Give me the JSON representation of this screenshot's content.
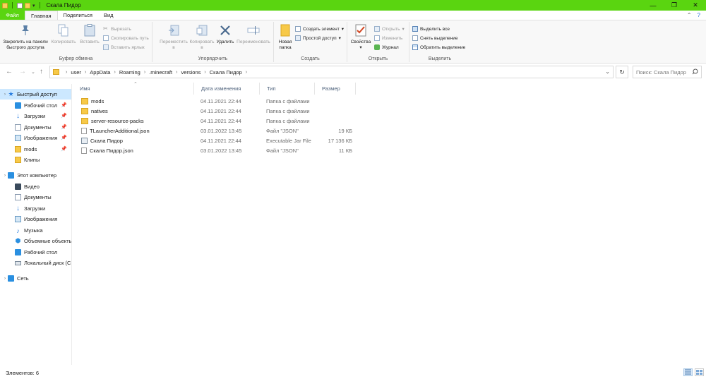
{
  "window": {
    "title": "Скала Пидор",
    "controls": {
      "minimize": "—",
      "maximize": "❐",
      "close": "✕"
    },
    "accent_color": "#5ad510"
  },
  "ribbon_tabs": [
    "Файл",
    "Главная",
    "Поделиться",
    "Вид"
  ],
  "ribbon": {
    "clipboard": {
      "label": "Буфер обмена",
      "pin": "Закрепить на панели быстрого доступа",
      "copy": "Копировать",
      "paste": "Вставить",
      "cut": "Вырезать",
      "copy_path": "Скопировать путь",
      "paste_shortcut": "Вставить ярлык"
    },
    "organize": {
      "label": "Упорядочить",
      "move": "Переместить в",
      "copy_to": "Копировать в",
      "delete": "Удалить",
      "rename": "Переименовать"
    },
    "create": {
      "label": "Создать",
      "new_folder": "Новая папка",
      "new_item": "Создать элемент",
      "easy_access": "Простой доступ"
    },
    "open": {
      "label": "Открыть",
      "properties": "Свойства",
      "open": "Открыть",
      "edit": "Изменить",
      "history": "Журнал"
    },
    "select": {
      "label": "Выделить",
      "select_all": "Выделить все",
      "select_none": "Снять выделение",
      "invert": "Обратить выделение"
    }
  },
  "address": {
    "breadcrumbs": [
      "user",
      "AppData",
      "Roaming",
      ".minecraft",
      "versions",
      "Скала Пидор"
    ],
    "search_placeholder": "Поиск: Скала Пидор"
  },
  "sidebar": {
    "quick_access": "Быстрый доступ",
    "quick_items": [
      "Рабочий стол",
      "Загрузки",
      "Документы",
      "Изображения",
      "mods",
      "Клипы"
    ],
    "this_pc": "Этот компьютер",
    "pc_items": [
      "Видео",
      "Документы",
      "Загрузки",
      "Изображения",
      "Музыка",
      "Объемные объекты",
      "Рабочий стол",
      "Локальный диск (C:)"
    ],
    "network": "Сеть"
  },
  "columns": {
    "name": "Имя",
    "date": "Дата изменения",
    "type": "Тип",
    "size": "Размер"
  },
  "files": [
    {
      "name": "mods",
      "date": "04.11.2021 22:44",
      "type": "Папка с файлами",
      "size": "",
      "icon": "folder"
    },
    {
      "name": "natives",
      "date": "04.11.2021 22:44",
      "type": "Папка с файлами",
      "size": "",
      "icon": "folder"
    },
    {
      "name": "server-resource-packs",
      "date": "04.11.2021 22:44",
      "type": "Папка с файлами",
      "size": "",
      "icon": "folder"
    },
    {
      "name": "TLauncherAdditional.json",
      "date": "03.01.2022 13:45",
      "type": "Файл \"JSON\"",
      "size": "19 КБ",
      "icon": "file"
    },
    {
      "name": "Скала Пидор",
      "date": "04.11.2021 22:44",
      "type": "Executable Jar File",
      "size": "17 136 КБ",
      "icon": "jar"
    },
    {
      "name": "Скала Пидор.json",
      "date": "03.01.2022 13:45",
      "type": "Файл \"JSON\"",
      "size": "11 КБ",
      "icon": "file"
    }
  ],
  "status": {
    "items_count": "Элементов: 6"
  }
}
